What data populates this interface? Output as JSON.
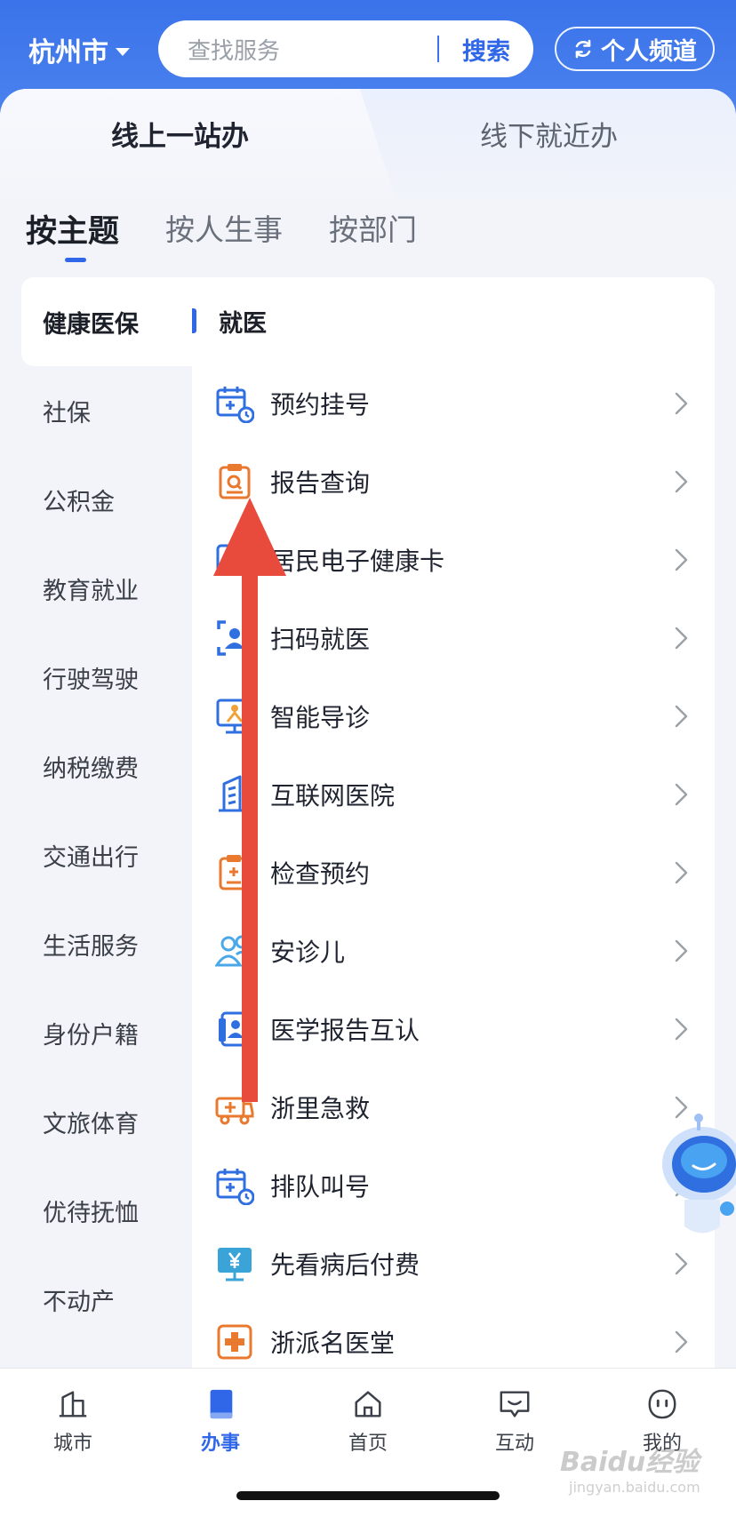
{
  "header": {
    "city": "杭州市",
    "search_placeholder": "查找服务",
    "search_button": "搜索",
    "channel_button": "个人频道"
  },
  "mode_tabs": [
    {
      "label": "线上一站办",
      "active": true
    },
    {
      "label": "线下就近办",
      "active": false
    }
  ],
  "category_tabs": [
    {
      "label": "按主题",
      "active": true
    },
    {
      "label": "按人生事",
      "active": false
    },
    {
      "label": "按部门",
      "active": false
    }
  ],
  "left_nav": [
    {
      "label": "健康医保",
      "active": true
    },
    {
      "label": "社保"
    },
    {
      "label": "公积金"
    },
    {
      "label": "教育就业"
    },
    {
      "label": "行驶驾驶"
    },
    {
      "label": "纳税缴费"
    },
    {
      "label": "交通出行"
    },
    {
      "label": "生活服务"
    },
    {
      "label": "身份户籍"
    },
    {
      "label": "文旅体育"
    },
    {
      "label": "优待抚恤"
    },
    {
      "label": "不动产"
    }
  ],
  "section": {
    "title": "就医"
  },
  "services": [
    {
      "label": "预约挂号",
      "icon": "calendar-clock-icon",
      "color": "#2f6fe0"
    },
    {
      "label": "报告查询",
      "icon": "report-search-icon",
      "color": "#e8792f"
    },
    {
      "label": "居民电子健康卡",
      "icon": "health-card-icon",
      "color": "#2f6fe0"
    },
    {
      "label": "扫码就医",
      "icon": "scan-person-icon",
      "color": "#2f6fe0"
    },
    {
      "label": "智能导诊",
      "icon": "monitor-guide-icon",
      "color": "#2f6fe0"
    },
    {
      "label": "互联网医院",
      "icon": "building-icon",
      "color": "#2f6fe0"
    },
    {
      "label": "检查预约",
      "icon": "clipboard-plus-icon",
      "color": "#e8792f"
    },
    {
      "label": "安诊儿",
      "icon": "people-icon",
      "color": "#4aa8e8"
    },
    {
      "label": "医学报告互认",
      "icon": "report-person-icon",
      "color": "#2f6fe0"
    },
    {
      "label": "浙里急救",
      "icon": "ambulance-icon",
      "color": "#e8792f"
    },
    {
      "label": "排队叫号",
      "icon": "calendar-clock-icon",
      "color": "#2f6fe0"
    },
    {
      "label": "先看病后付费",
      "icon": "monitor-yen-icon",
      "color": "#3aa3d8"
    },
    {
      "label": "浙派名医堂",
      "icon": "clinic-cross-icon",
      "color": "#e8792f"
    }
  ],
  "bottom_nav": [
    {
      "label": "城市",
      "icon": "city-icon",
      "active": false
    },
    {
      "label": "办事",
      "icon": "book-icon",
      "active": true
    },
    {
      "label": "首页",
      "icon": "home-icon",
      "active": false
    },
    {
      "label": "互动",
      "icon": "chat-icon",
      "active": false
    },
    {
      "label": "我的",
      "icon": "face-icon",
      "active": false
    }
  ],
  "watermark": {
    "brand": "Baidu经验",
    "url": "jingyan.baidu.com"
  },
  "colors": {
    "primary": "#2f67e8",
    "header_bg": "#3a73ea",
    "annotation_arrow": "#e84a3c"
  }
}
